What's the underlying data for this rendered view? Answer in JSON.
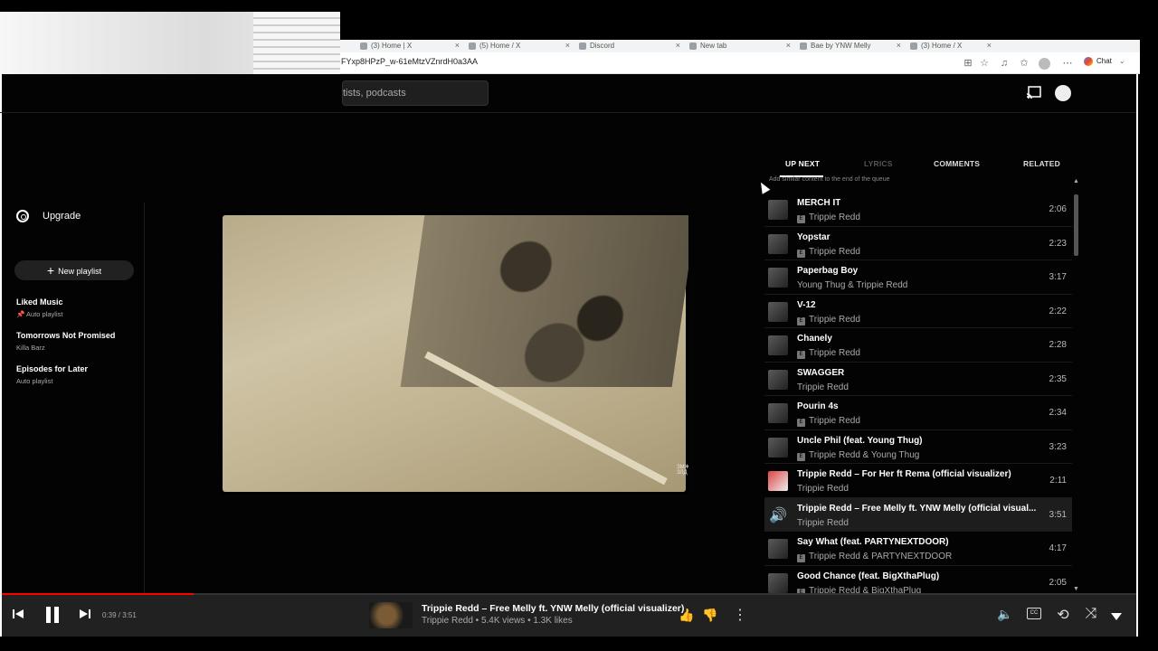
{
  "browser": {
    "tabs": [
      "(3) Home | X",
      "(5) Home / X",
      "Discord",
      "New tab",
      "Bae by YNW Melly",
      "(3) Home / X"
    ],
    "url": "FYxp8HPzP_w-61eMtzVZnrdH0a3AA",
    "chat_label": "Chat"
  },
  "header": {
    "search_placeholder": "tists, podcasts"
  },
  "sidebar": {
    "upgrade_label": "Upgrade",
    "new_playlist_label": "New playlist",
    "playlists": [
      {
        "title": "Liked Music",
        "subtitle": "Auto playlist",
        "pinned": true
      },
      {
        "title": "Tomorrows Not Promised",
        "subtitle": "Killa Barz",
        "pinned": false
      },
      {
        "title": "Episodes for Later",
        "subtitle": "Auto playlist",
        "pinned": false
      }
    ]
  },
  "video": {
    "watermark": "ЗМЖ ЗЛД"
  },
  "panel": {
    "tabs": [
      {
        "label": "UP NEXT",
        "active": true
      },
      {
        "label": "LYRICS",
        "active": false,
        "disabled": true
      },
      {
        "label": "COMMENTS",
        "active": false
      },
      {
        "label": "RELATED",
        "active": false
      }
    ],
    "queue_note": "Add similar content to the end of the queue",
    "queue": [
      {
        "title": "MERCH IT",
        "artist": "Trippie Redd",
        "explicit": true,
        "duration": "2:06"
      },
      {
        "title": "Yopstar",
        "artist": "Trippie Redd",
        "explicit": true,
        "duration": "2:23"
      },
      {
        "title": "Paperbag Boy",
        "artist": "Young Thug & Trippie Redd",
        "explicit": false,
        "duration": "3:17"
      },
      {
        "title": "V-12",
        "artist": "Trippie Redd",
        "explicit": true,
        "duration": "2:22"
      },
      {
        "title": "Chanely",
        "artist": "Trippie Redd",
        "explicit": true,
        "duration": "2:28"
      },
      {
        "title": "SWAGGER",
        "artist": "Trippie Redd",
        "explicit": false,
        "duration": "2:35"
      },
      {
        "title": "Pourin 4s",
        "artist": "Trippie Redd",
        "explicit": true,
        "duration": "2:34"
      },
      {
        "title": "Uncle Phil (feat. Young Thug)",
        "artist": "Trippie Redd & Young Thug",
        "explicit": true,
        "duration": "3:23"
      },
      {
        "title": "Trippie Redd – For Her ft Rema (official visualizer)",
        "artist": "Trippie Redd",
        "explicit": false,
        "duration": "2:11"
      },
      {
        "title": "Trippie Redd – Free Melly ft. YNW Melly (official visual...",
        "artist": "Trippie Redd",
        "explicit": false,
        "duration": "3:51",
        "playing": true
      },
      {
        "title": "Say What (feat. PARTYNEXTDOOR)",
        "artist": "Trippie Redd & PARTYNEXTDOOR",
        "explicit": true,
        "duration": "4:17"
      },
      {
        "title": "Good Chance (feat. BigXthaPlug)",
        "artist": "Trippie Redd & BigXthaPlug",
        "explicit": true,
        "duration": "2:05"
      }
    ]
  },
  "player": {
    "time": "0:39 / 3:51",
    "progress": 0.169,
    "title": "Trippie Redd – Free Melly ft. YNW Melly (official visualizer)",
    "subtitle": "Trippie Redd • 5.4K views • 1.3K likes",
    "accent": "#ff0000"
  }
}
